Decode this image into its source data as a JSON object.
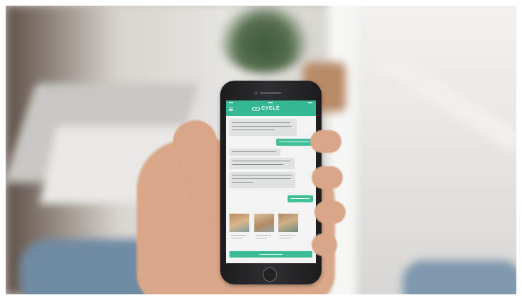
{
  "scene": {
    "description_tags": [
      "hand-holding-phone",
      "window",
      "plant",
      "blurred-room"
    ]
  },
  "app": {
    "brand_name": "CYCLE",
    "accent_color": "#35b893",
    "logo_icon": "interlocking-circles-icon",
    "menu_icon": "hamburger-menu-icon"
  },
  "chat": {
    "messages": [
      {
        "sender": "bot",
        "lines": 3
      },
      {
        "sender": "user",
        "lines": 1
      },
      {
        "sender": "bot",
        "lines": 1
      },
      {
        "sender": "bot",
        "lines": 2
      },
      {
        "sender": "bot",
        "lines": 3
      },
      {
        "sender": "user",
        "lines": 1
      }
    ],
    "cards": 3,
    "cta_button": true
  }
}
